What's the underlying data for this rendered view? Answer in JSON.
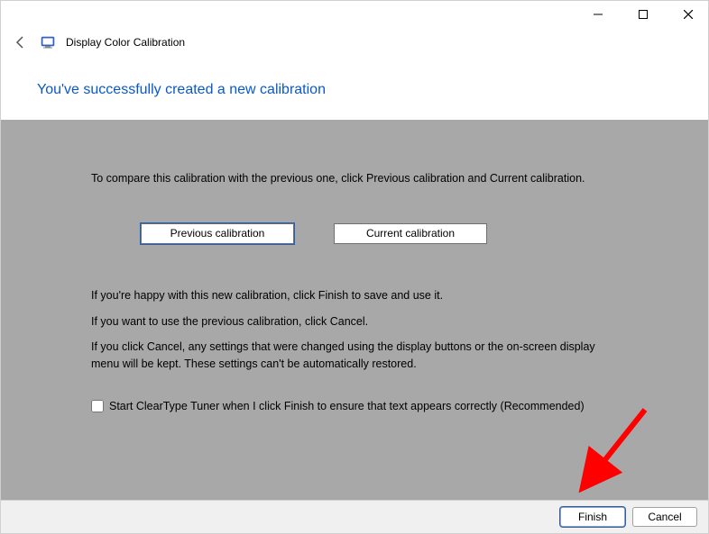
{
  "titlebar": {
    "minimize": "—",
    "maximize": "▢",
    "close": "✕"
  },
  "header": {
    "app_title": "Display Color Calibration"
  },
  "heading": "You've successfully created a new calibration",
  "content": {
    "intro": "To compare this calibration with the previous one, click Previous calibration and Current calibration.",
    "btn_previous": "Previous calibration",
    "btn_current": "Current calibration",
    "para1": "If you're happy with this new calibration, click Finish to save and use it.",
    "para2": "If you want to use the previous calibration, click Cancel.",
    "para3": "If you click Cancel, any settings that were changed using the display buttons or the on-screen display menu will be kept. These settings can't be automatically restored.",
    "checkbox_label": "Start ClearType Tuner when I click Finish to ensure that text appears correctly (Recommended)"
  },
  "footer": {
    "finish": "Finish",
    "cancel": "Cancel"
  }
}
